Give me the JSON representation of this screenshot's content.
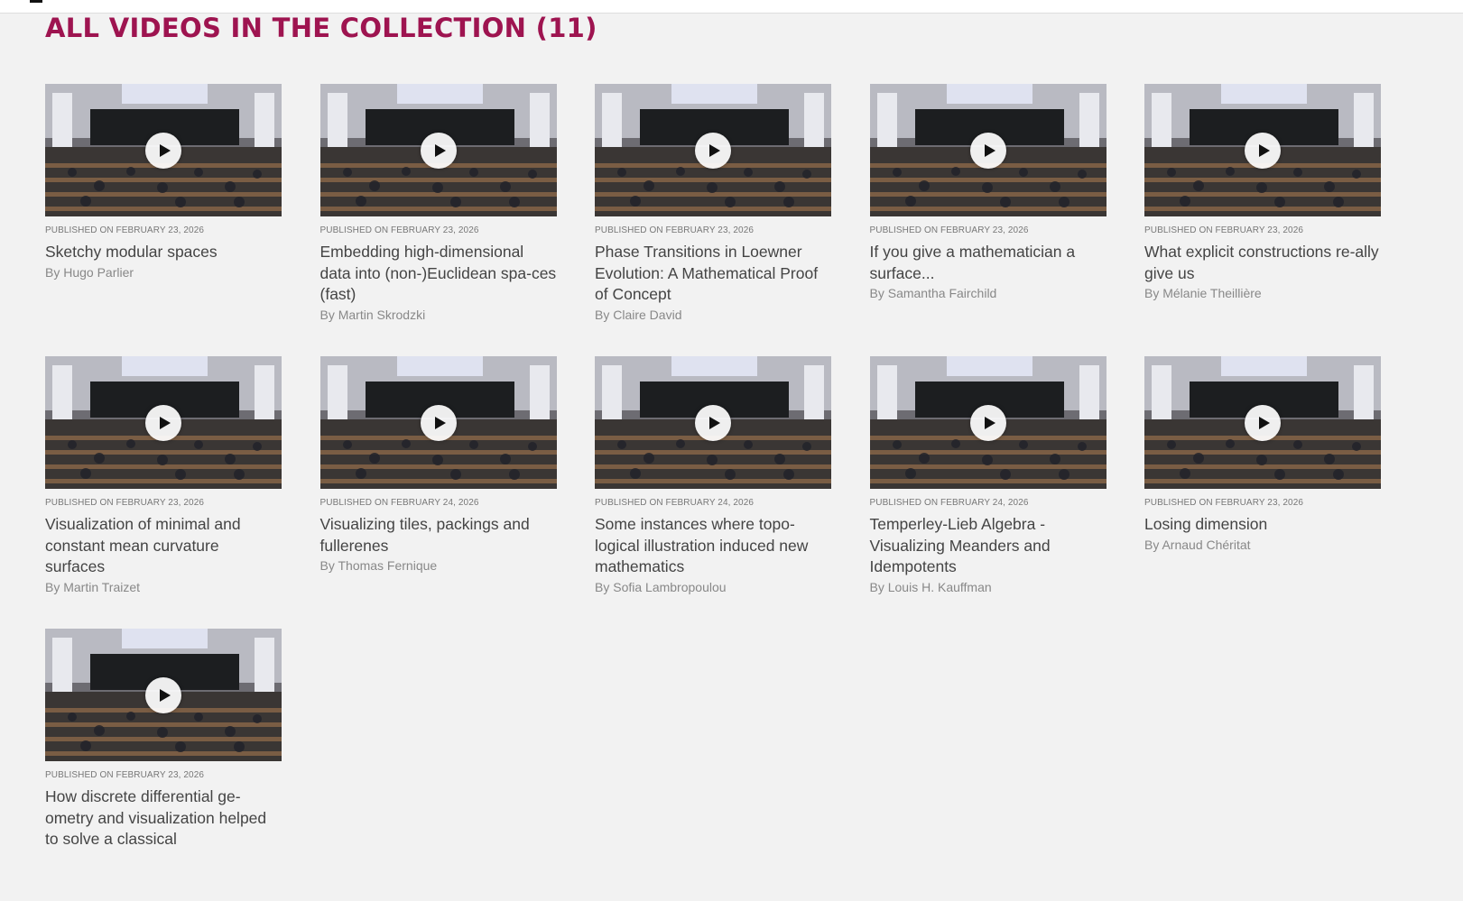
{
  "collection": {
    "heading": "ALL VIDEOS IN THE COLLECTION (11)"
  },
  "colors": {
    "heading": "#9e1450",
    "background": "#f2f2f2"
  },
  "videos": [
    {
      "date": "PUBLISHED ON FEBRUARY 23, 2026",
      "title": "Sketchy modular spaces",
      "author": "By Hugo Parlier"
    },
    {
      "date": "PUBLISHED ON FEBRUARY 23, 2026",
      "title": "Embedding high-dimensional data into (non-)Euclidean spa-ces (fast)",
      "author": "By Martin Skrodzki"
    },
    {
      "date": "PUBLISHED ON FEBRUARY 23, 2026",
      "title": "Phase Transitions in Loewner Evolution: A Mathematical Proof of Concept",
      "author": "By Claire David"
    },
    {
      "date": "PUBLISHED ON FEBRUARY 23, 2026",
      "title": "If you give a mathematician a surface...",
      "author": "By Samantha Fairchild"
    },
    {
      "date": "PUBLISHED ON FEBRUARY 23, 2026",
      "title": "What explicit constructions re-ally give us",
      "author": "By Mélanie Theillière"
    },
    {
      "date": "PUBLISHED ON FEBRUARY 23, 2026",
      "title": "Visualization of minimal and constant mean curvature surfaces",
      "author": "By Martin Traizet"
    },
    {
      "date": "PUBLISHED ON FEBRUARY 24, 2026",
      "title": "Visualizing tiles, packings and fullerenes",
      "author": "By Thomas Fernique"
    },
    {
      "date": "PUBLISHED ON FEBRUARY 24, 2026",
      "title": "Some instances where topo-logical illustration induced new mathematics",
      "author": "By Sofia Lambropoulou"
    },
    {
      "date": "PUBLISHED ON FEBRUARY 24, 2026",
      "title": "Temperley-Lieb Algebra - Visualizing Meanders and Idempotents",
      "author": "By Louis H. Kauffman"
    },
    {
      "date": "PUBLISHED ON FEBRUARY 23, 2026",
      "title": "Losing dimension",
      "author": "By Arnaud Chéritat"
    },
    {
      "date": "PUBLISHED ON FEBRUARY 23, 2026",
      "title": "How discrete differential ge-ometry and visualization helped to solve a classical",
      "author": ""
    }
  ],
  "icons": {
    "play": "play-icon"
  }
}
